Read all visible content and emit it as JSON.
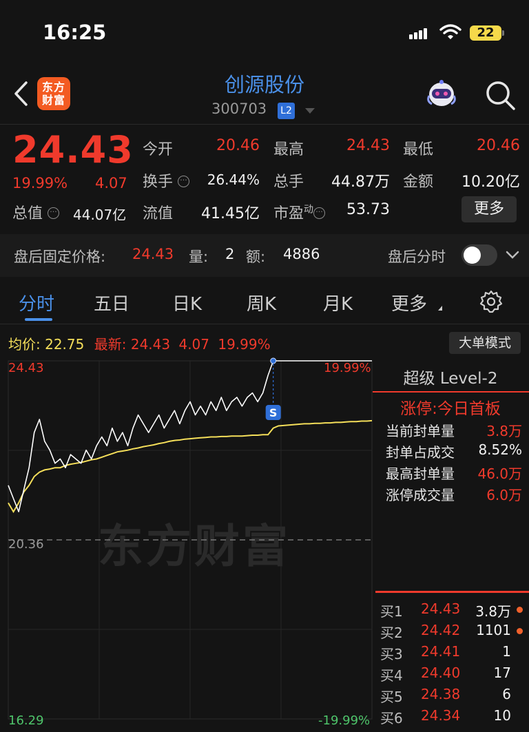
{
  "status_bar": {
    "time": "16:25",
    "battery": "22"
  },
  "nav": {
    "logo_text": "东方财富",
    "stock_name": "创源股份",
    "stock_code": "300703",
    "level_badge": "L2"
  },
  "quote": {
    "price": "24.43",
    "change_pct": "19.99%",
    "change": "4.07",
    "market_cap_label": "总值",
    "market_cap": "44.07亿",
    "fields": [
      {
        "label": "今开",
        "value": "20.46"
      },
      {
        "label": "最高",
        "value": "24.43"
      },
      {
        "label": "最低",
        "value": "20.46"
      },
      {
        "label": "换手",
        "value": "26.44%"
      },
      {
        "label": "总手",
        "value": "44.87万"
      },
      {
        "label": "金额",
        "value": "10.20亿"
      },
      {
        "label": "流值",
        "value": "41.45亿"
      },
      {
        "label": "市盈",
        "label_sup": "动",
        "value": "53.73"
      }
    ],
    "more_label": "更多"
  },
  "after_hours": {
    "label": "盘后固定价格:",
    "price": "24.43",
    "volume_label": "量:",
    "volume": "2",
    "amount_label": "额:",
    "amount": "4886",
    "time_label": "盘后分时"
  },
  "tabs": [
    "分时",
    "五日",
    "日K",
    "周K",
    "月K",
    "更多"
  ],
  "chart_header": {
    "avg_label": "均价:",
    "avg_value": "22.75",
    "latest_label": "最新:",
    "latest_price": "24.43",
    "latest_change": "4.07",
    "latest_pct": "19.99%",
    "big_order_button": "大单模式"
  },
  "chart_data": {
    "type": "line",
    "y_max_label": "24.43",
    "y_mid_label": "20.36",
    "y_min_label": "16.29",
    "pct_max_label": "19.99%",
    "pct_min_label": "-19.99%",
    "ylim": [
      16.29,
      24.43
    ],
    "reference_price": 20.36,
    "limit_marker": "S",
    "watermark": "东方财富",
    "series": [
      {
        "values": [
          21.6,
          21.3,
          21.0,
          21.5,
          22.0,
          22.8,
          23.1,
          22.6,
          22.4,
          22.1,
          22.2,
          22.0,
          22.3,
          22.2,
          22.1,
          22.4,
          22.2,
          22.5,
          22.7,
          22.5,
          22.9,
          22.6,
          22.8,
          22.5,
          22.9,
          23.2,
          23.0,
          22.8,
          23.0,
          23.2,
          22.9,
          23.1,
          23.3,
          23.0,
          23.3,
          23.5,
          23.2,
          23.4,
          23.2,
          23.5,
          23.3,
          23.6,
          23.3,
          23.5,
          23.6,
          23.4,
          23.6,
          23.7,
          23.5,
          23.7,
          24.1,
          24.43,
          24.43,
          24.43,
          24.43,
          24.43,
          24.43,
          24.43,
          24.43,
          24.43,
          24.43,
          24.43,
          24.43,
          24.43,
          24.43,
          24.43,
          24.43,
          24.43,
          24.43,
          24.43,
          24.43
        ]
      },
      {
        "values": [
          21.2,
          21.0,
          21.2,
          21.45,
          21.6,
          21.8,
          21.9,
          21.95,
          21.97,
          22.0,
          22.0,
          22.05,
          22.08,
          22.1,
          22.12,
          22.15,
          22.18,
          22.2,
          22.24,
          22.28,
          22.32,
          22.36,
          22.38,
          22.4,
          22.43,
          22.45,
          22.48,
          22.5,
          22.52,
          22.55,
          22.57,
          22.6,
          22.62,
          22.63,
          22.65,
          22.66,
          22.67,
          22.68,
          22.69,
          22.7,
          22.7,
          22.71,
          22.71,
          22.72,
          22.72,
          22.72,
          22.73,
          22.74,
          22.74,
          22.75,
          22.75,
          22.9,
          22.95,
          22.96,
          22.97,
          22.98,
          22.99,
          23.0,
          23.0,
          23.01,
          23.01,
          23.02,
          23.02,
          23.03,
          23.03,
          23.04,
          23.05,
          23.05,
          23.06,
          23.06,
          23.07
        ]
      }
    ]
  },
  "level2": {
    "title": "超级 Level-2",
    "limit_status": "涨停:今日首板",
    "rows": [
      {
        "label": "当前封单量",
        "value": "3.8万"
      },
      {
        "label": "封单占成交",
        "value": "8.52%"
      },
      {
        "label": "最高封单量",
        "value": "46.0万"
      },
      {
        "label": "涨停成交量",
        "value": "6.0万"
      }
    ],
    "order_book": [
      {
        "label": "买1",
        "price": "24.43",
        "volume": "3.8万"
      },
      {
        "label": "买2",
        "price": "24.42",
        "volume": "1101"
      },
      {
        "label": "买3",
        "price": "24.41",
        "volume": "1"
      },
      {
        "label": "买4",
        "price": "24.40",
        "volume": "17"
      },
      {
        "label": "买5",
        "price": "24.38",
        "volume": "6"
      },
      {
        "label": "买6",
        "price": "24.34",
        "volume": "10"
      }
    ]
  },
  "colors": {
    "up": "#f03a2c",
    "accent": "#4a90e8",
    "avg_line": "#f5df5a",
    "bg": "#141414"
  }
}
